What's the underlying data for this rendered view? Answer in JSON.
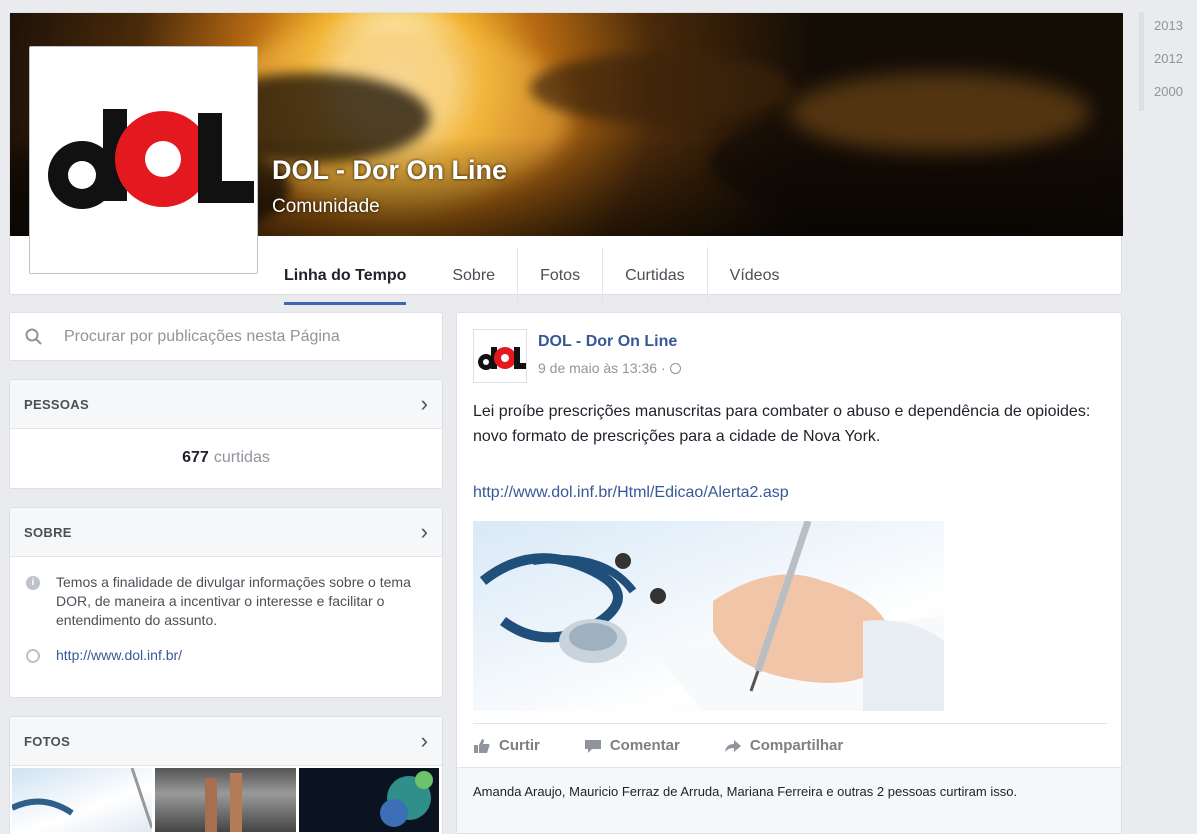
{
  "page": {
    "name": "DOL - Dor On Line",
    "category": "Comunidade",
    "logo_text": "dOL"
  },
  "tabs": [
    {
      "label": "Linha do Tempo",
      "active": true
    },
    {
      "label": "Sobre"
    },
    {
      "label": "Fotos"
    },
    {
      "label": "Curtidas"
    },
    {
      "label": "Vídeos"
    }
  ],
  "years": [
    "2013",
    "2012",
    "2000"
  ],
  "search": {
    "placeholder": "Procurar por publicações nesta Página"
  },
  "people": {
    "title": "PESSOAS",
    "likes_count": "677",
    "likes_label": "curtidas"
  },
  "about": {
    "title": "SOBRE",
    "description": "Temos a finalidade de divulgar informações sobre o tema DOR, de maneira a incentivar o interesse e facilitar o entendimento do assunto.",
    "website": "http://www.dol.inf.br/"
  },
  "photos": {
    "title": "FOTOS"
  },
  "post": {
    "author": "DOL - Dor On Line",
    "time": "9 de maio às 13:36 · ",
    "text": "Lei proíbe prescrições manuscritas para combater o abuso e dependência de opioides: novo formato de prescrições para a cidade de Nova York.",
    "link": "http://www.dol.inf.br/Html/Edicao/Alerta2.asp",
    "actions": {
      "like": "Curtir",
      "comment": "Comentar",
      "share": "Compartilhar"
    },
    "likes_summary": "Amanda Araujo, Mauricio Ferraz de Arruda, Mariana Ferreira e outras 2 pessoas curtiram isso."
  },
  "colors": {
    "link": "#365899",
    "accent": "#4267b2",
    "logo_red": "#e3191f"
  }
}
